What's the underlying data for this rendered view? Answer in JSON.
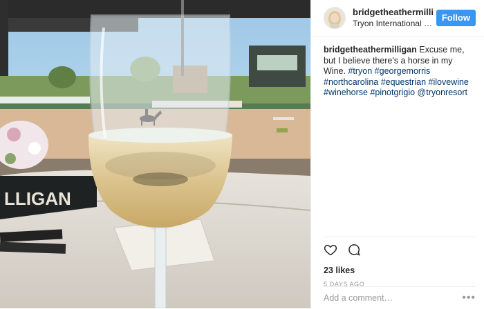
{
  "post": {
    "photo_alt": "Wine glass reflecting a horse arena",
    "name_card_text": "LLIGAN"
  },
  "header": {
    "username": "bridgetheathermilligan",
    "location": "Tryon International E...",
    "follow_label": "Follow"
  },
  "caption": {
    "username": "bridgetheathermilligan",
    "text": "Excuse me, but I believe there's a horse in my Wine.",
    "hashtags": [
      "#tryon",
      "#georgemorris",
      "#northcarolina",
      "#equestrian",
      "#ilovewine",
      "#winehorse",
      "#pinotgrigio"
    ],
    "mention": "@tryonresort"
  },
  "actions": {
    "like_icon": "heart-icon",
    "comment_icon": "comment-icon",
    "likes": "23 likes",
    "date": "5 DAYS AGO"
  },
  "comment_box": {
    "placeholder": "Add a comment…",
    "more_icon": "ellipsis-icon",
    "more_label": "•••"
  }
}
